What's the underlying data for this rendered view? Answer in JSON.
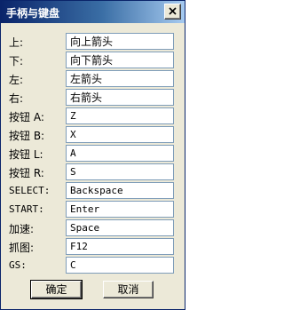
{
  "window": {
    "title": "手柄与键盘",
    "close_icon": "close-icon"
  },
  "fields": [
    {
      "label": "上:",
      "value": "向上箭头"
    },
    {
      "label": "下:",
      "value": "向下箭头"
    },
    {
      "label": "左:",
      "value": "左箭头"
    },
    {
      "label": "右:",
      "value": "右箭头"
    },
    {
      "label": "按钮 A:",
      "value": "Z"
    },
    {
      "label": "按钮 B:",
      "value": "X"
    },
    {
      "label": "按钮 L:",
      "value": "A"
    },
    {
      "label": "按钮 R:",
      "value": "S"
    },
    {
      "label": "SELECT:",
      "value": "Backspace"
    },
    {
      "label": "START:",
      "value": "Enter"
    },
    {
      "label": "加速:",
      "value": "Space"
    },
    {
      "label": "抓图:",
      "value": "F12"
    },
    {
      "label": "GS:",
      "value": "C"
    }
  ],
  "buttons": {
    "ok": "确定",
    "cancel": "取消"
  }
}
